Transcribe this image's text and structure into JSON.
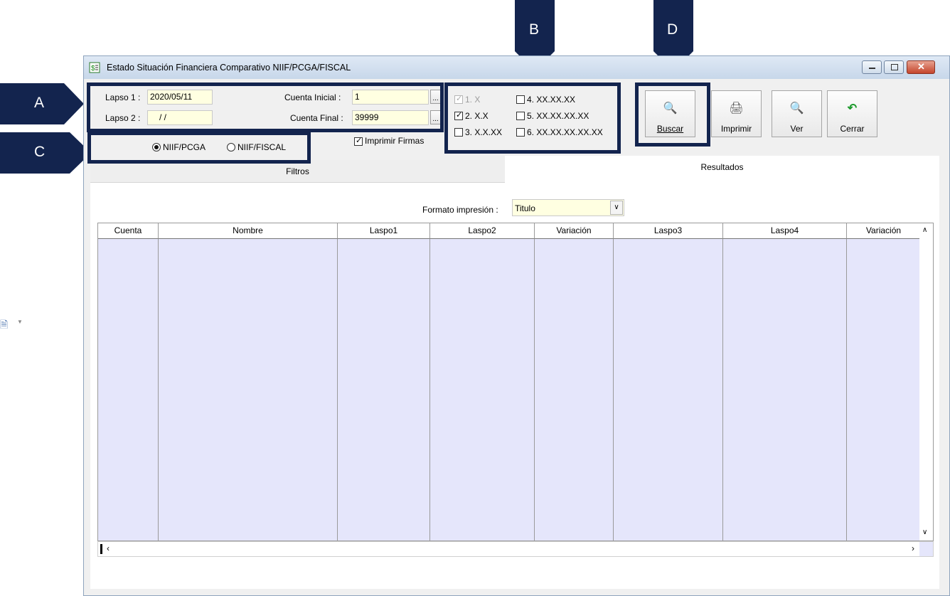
{
  "window": {
    "title": "Estado Situación Financiera Comparativo NIIF/PCGA/FISCAL"
  },
  "filters": {
    "lapso1_label": "Lapso 1 :",
    "lapso1_value": "2020/05/11",
    "lapso2_label": "Lapso 2 :",
    "lapso2_value": "/ /",
    "cuenta_inicial_label": "Cuenta Inicial :",
    "cuenta_inicial_value": "1",
    "cuenta_final_label": "Cuenta Final :",
    "cuenta_final_value": "39999",
    "browse_label": "...",
    "norm_options": [
      "NIIF/PCGA",
      "NIIF/FISCAL"
    ],
    "norm_selected": "NIIF/PCGA",
    "imprimir_firmas_label": "Imprimir Firmas",
    "imprimir_firmas_checked": true
  },
  "levels": [
    {
      "label": "1. X",
      "checked": true,
      "disabled": true
    },
    {
      "label": "2. X.X",
      "checked": true,
      "disabled": false
    },
    {
      "label": "3. X.X.XX",
      "checked": false,
      "disabled": false
    },
    {
      "label": "4. XX.XX.XX",
      "checked": false,
      "disabled": false
    },
    {
      "label": "5. XX.XX.XX.XX",
      "checked": false,
      "disabled": false
    },
    {
      "label": "6. XX.XX.XX.XX.XX",
      "checked": false,
      "disabled": false
    }
  ],
  "toolbar": {
    "buscar_label": "Buscar",
    "imprimir_label": "Imprimir",
    "ver_label": "Ver",
    "cerrar_label": "Cerrar"
  },
  "tabs": [
    "Filtros",
    "Resultados"
  ],
  "results": {
    "formato_label": "Formato impresión :",
    "formato_value": "Titulo",
    "columns": [
      "Cuenta",
      "Nombre",
      "Laspo1",
      "Laspo2",
      "Variación",
      "Laspo3",
      "Laspo4",
      "Variación"
    ]
  },
  "callouts": [
    "A",
    "B",
    "C",
    "D"
  ],
  "colors": {
    "callout": "#13244e",
    "field_bg": "#ffffe1",
    "grid_bg": "#e5e6fb"
  }
}
